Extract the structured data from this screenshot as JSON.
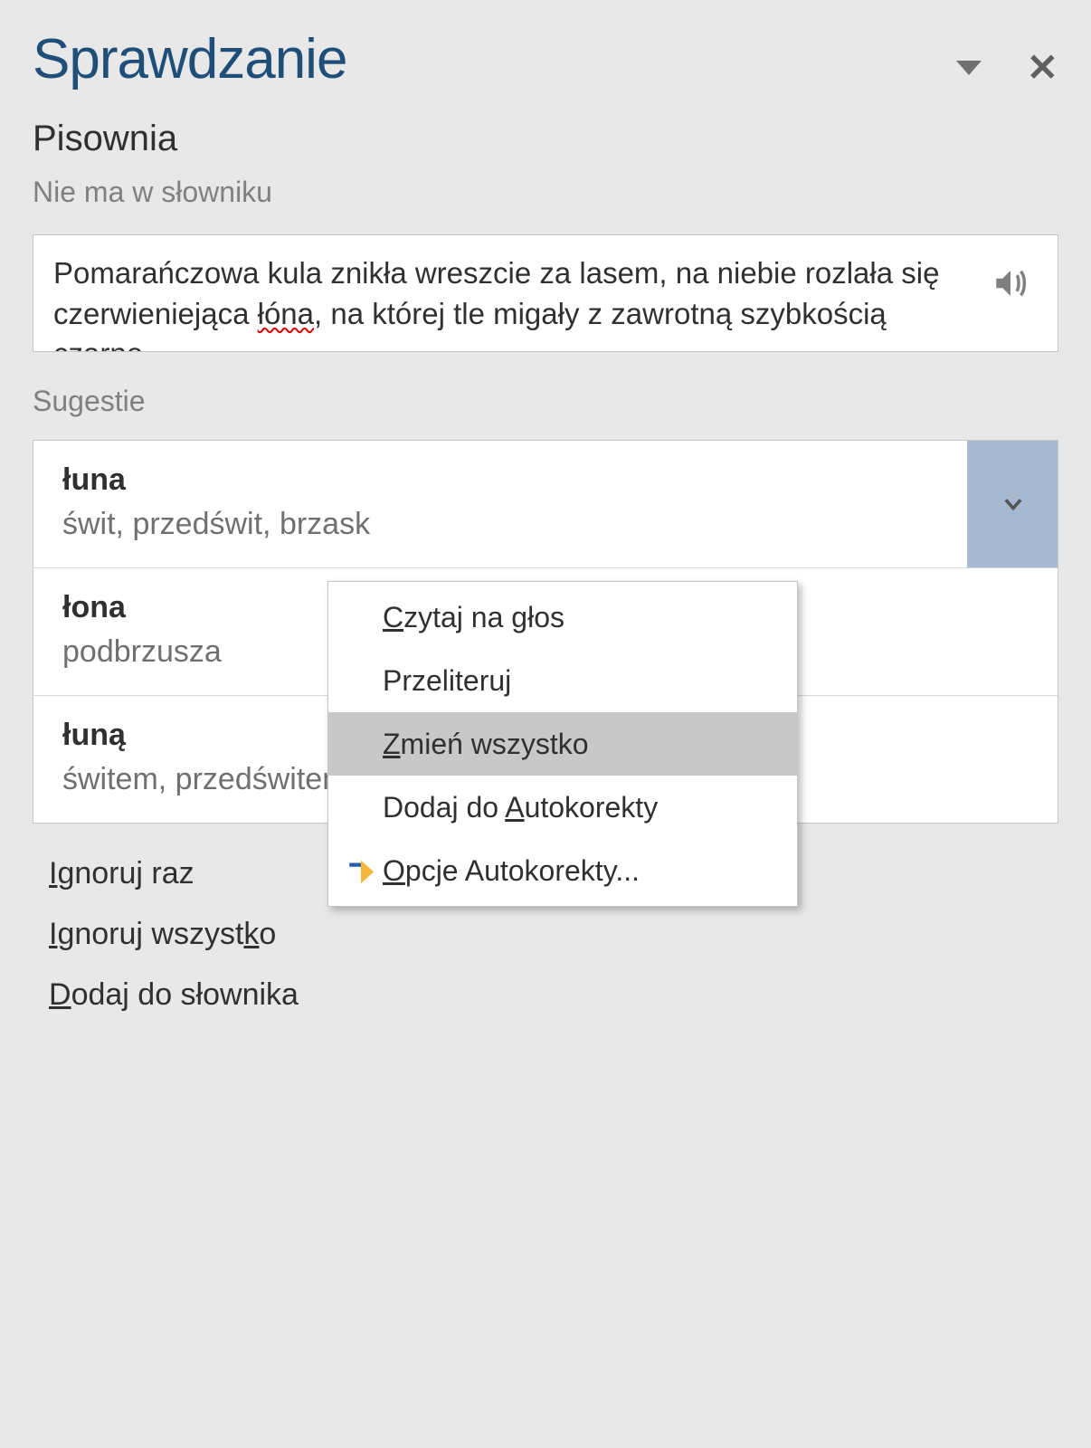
{
  "pane": {
    "title": "Sprawdzanie",
    "subtitle": "Pisownia",
    "not_in_dict": "Nie ma w słowniku"
  },
  "context_sentence": {
    "before": "Pomarańczowa kula znikła wreszcie za lasem, na niebie rozlała się czerwieniejąca ",
    "error_word": "łóna",
    "after": ", na której tle migały z zawrotną szybkością czarne"
  },
  "suggestions_label": "Sugestie",
  "suggestions": [
    {
      "word": "łuna",
      "synonyms": "świt, przedświt, brzask",
      "selected": true
    },
    {
      "word": "łona",
      "synonyms": "podbrzusza",
      "selected": false
    },
    {
      "word": "łuną",
      "synonyms": "świtem, przedświtem, b",
      "selected": false
    }
  ],
  "context_menu": [
    {
      "label_pre": "",
      "mnemonic": "C",
      "label_post": "zytaj na głos",
      "hover": false,
      "icon": null
    },
    {
      "label_pre": "Przeliteruj",
      "mnemonic": "",
      "label_post": "",
      "hover": false,
      "icon": null
    },
    {
      "label_pre": "",
      "mnemonic": "Z",
      "label_post": "mień wszystko",
      "hover": true,
      "icon": null
    },
    {
      "label_pre": "Dodaj do ",
      "mnemonic": "A",
      "label_post": "utokorekty",
      "hover": false,
      "icon": null
    },
    {
      "label_pre": "",
      "mnemonic": "O",
      "label_post": "pcje Autokorekty...",
      "hover": false,
      "icon": "autocorrect"
    }
  ],
  "actions": {
    "ignore_once": {
      "pre": "",
      "mn": "I",
      "post": "gnoruj raz"
    },
    "ignore_all": {
      "pre": "",
      "mn": "I",
      "post1": "gnoruj wszyst",
      "mn2": "k",
      "post2": "o"
    },
    "add_dict": {
      "pre": "",
      "mn": "D",
      "post": "odaj do słownika"
    }
  },
  "colors": {
    "accent": "#1f4e79",
    "dropdown_bg": "#a7b9d0"
  }
}
